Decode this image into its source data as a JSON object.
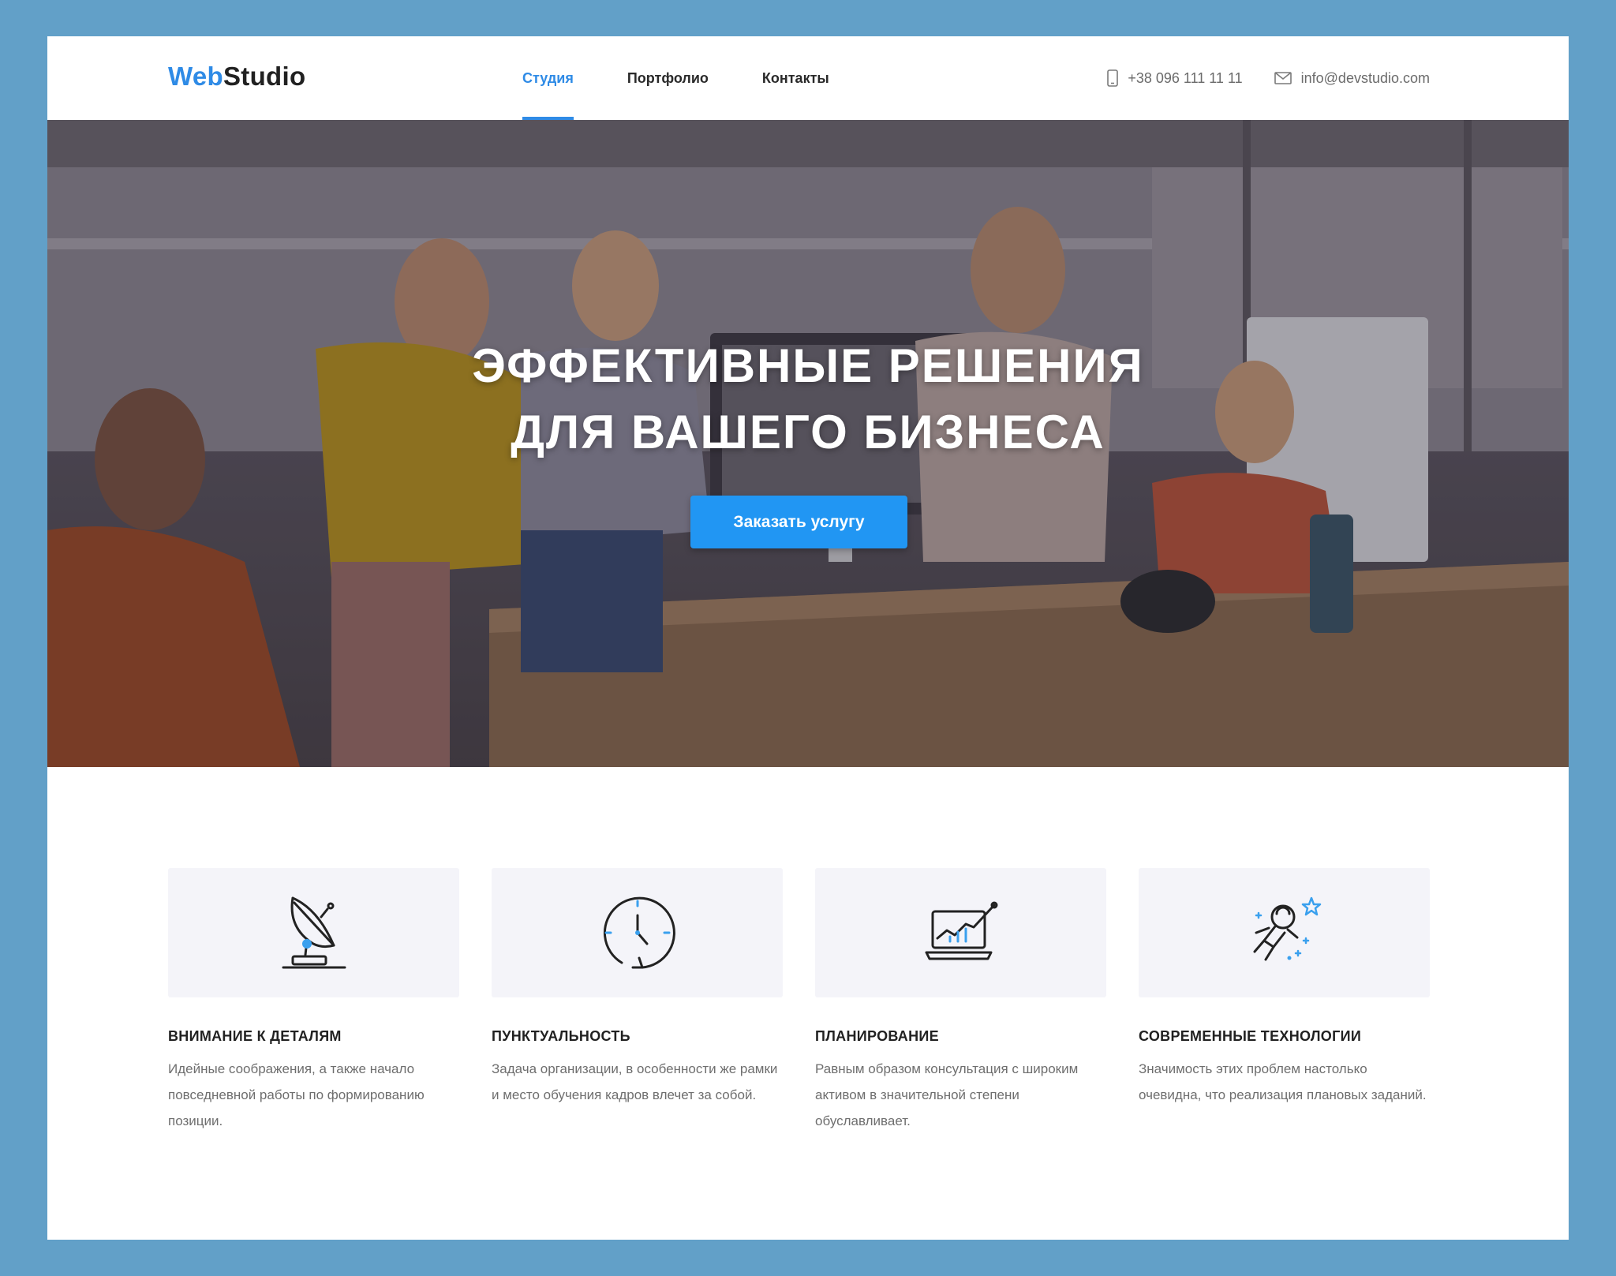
{
  "header": {
    "logo_part1": "Web",
    "logo_part2": "Studio",
    "nav": [
      {
        "label": "Студия",
        "active": true
      },
      {
        "label": "Портфолио",
        "active": false
      },
      {
        "label": "Контакты",
        "active": false
      }
    ],
    "phone": "+38 096 111 11 11",
    "email": "info@devstudio.com"
  },
  "hero": {
    "title_line1": "ЭФФЕКТИВНЫЕ РЕШЕНИЯ",
    "title_line2": "ДЛЯ ВАШЕГО БИЗНЕСА",
    "cta_label": "Заказать услугу"
  },
  "features": [
    {
      "icon": "satellite-dish-icon",
      "title": "ВНИМАНИЕ К ДЕТАЛЯМ",
      "text": "Идейные соображения, а также начало повседневной работы по формированию позиции."
    },
    {
      "icon": "clock-icon",
      "title": "ПУНКТУАЛЬНОСТЬ",
      "text": "Задача организации, в особенности же рамки и место обучения кадров влечет за собой."
    },
    {
      "icon": "laptop-chart-icon",
      "title": "ПЛАНИРОВАНИЕ",
      "text": "Равным образом консультация с широким активом в значительной степени обуславливает."
    },
    {
      "icon": "astronaut-icon",
      "title": "СОВРЕМЕННЫЕ ТЕХНОЛОГИИ",
      "text": "Значимость этих проблем настолько очевидна, что реализация плановых заданий."
    }
  ],
  "colors": {
    "accent": "#2f8be6",
    "button": "#2196f3",
    "frame": "#62a0c8",
    "card": "#f4f4f9"
  }
}
